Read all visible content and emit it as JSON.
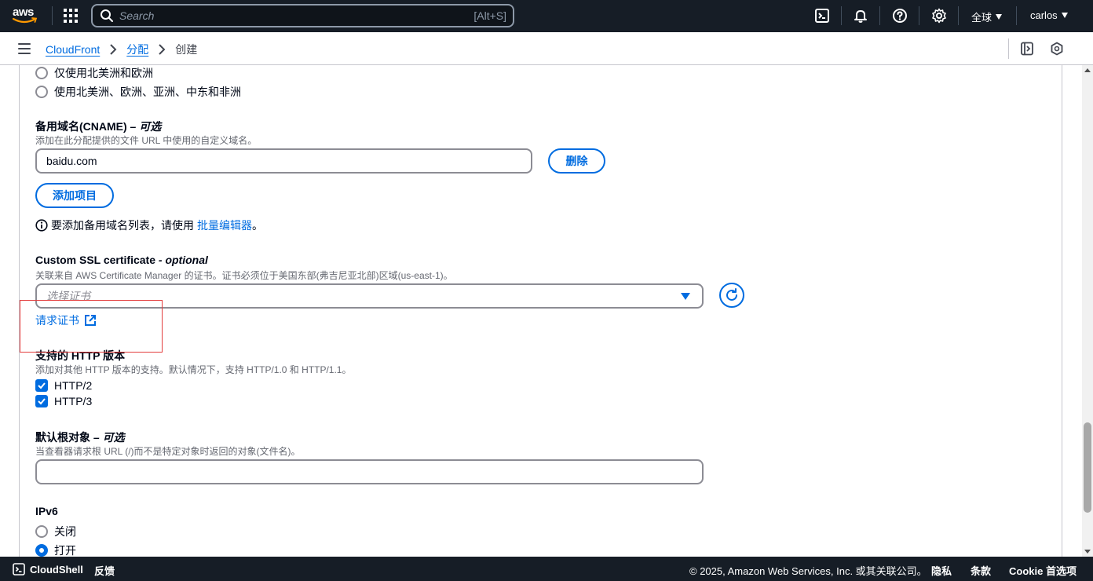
{
  "topnav": {
    "logo_text": "aws",
    "search_placeholder": "Search",
    "search_shortcut": "[Alt+S]",
    "region": "全球",
    "user": "carlos",
    "icons": [
      "services-grid-icon",
      "search-icon",
      "cloudshell-icon",
      "bell-icon",
      "help-icon",
      "gear-icon"
    ]
  },
  "breadcrumb": {
    "items": [
      "CloudFront",
      "分配"
    ],
    "current": "创建"
  },
  "form": {
    "price_class": {
      "options": [
        "仅使用北美洲和欧洲",
        "使用北美洲、欧洲、亚洲、中东和非洲"
      ]
    },
    "cname": {
      "label": "备用域名(CNAME)",
      "optional": "– 可选",
      "description": "添加在此分配提供的文件 URL 中使用的自定义域名。",
      "value": "baidu.com",
      "remove_button": "删除",
      "add_button": "添加项目",
      "info_text": "要添加备用域名列表，请使用",
      "info_link": "批量编辑器",
      "info_end": "。"
    },
    "ssl": {
      "label": "Custom SSL certificate",
      "optional": "- optional",
      "description": "关联来自 AWS Certificate Manager 的证书。证书必须位于美国东部(弗吉尼亚北部)区域(us-east-1)。",
      "placeholder": "选择证书",
      "request_link": "请求证书"
    },
    "http_versions": {
      "label": "支持的 HTTP 版本",
      "description": "添加对其他 HTTP 版本的支持。默认情况下，支持 HTTP/1.0 和 HTTP/1.1。",
      "options": [
        {
          "label": "HTTP/2",
          "checked": true
        },
        {
          "label": "HTTP/3",
          "checked": true
        }
      ]
    },
    "default_root": {
      "label": "默认根对象",
      "optional": "– 可选",
      "description": "当查看器请求根 URL (/)而不是特定对象时返回的对象(文件名)。",
      "value": ""
    },
    "ipv6": {
      "label": "IPv6",
      "options": [
        {
          "label": "关闭",
          "checked": false
        },
        {
          "label": "打开",
          "checked": true
        }
      ]
    }
  },
  "footer": {
    "cloudshell": "CloudShell",
    "feedback": "反馈",
    "copyright": "© 2025, Amazon Web Services, Inc. 或其关联公司。",
    "privacy": "隐私",
    "terms": "条款",
    "cookie": "Cookie 首选项"
  },
  "colors": {
    "nav_bg": "#161d26",
    "link": "#006ce0",
    "annotation": "#e33c3c"
  }
}
